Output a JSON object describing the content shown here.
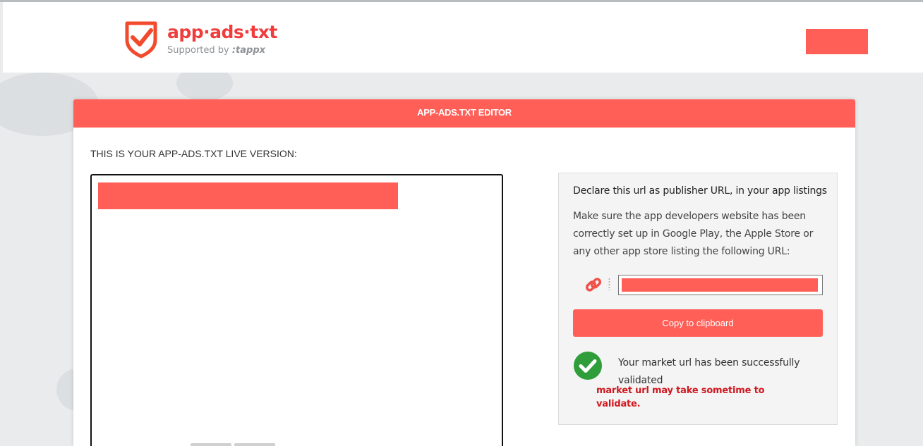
{
  "header": {
    "logo_name": "app·ads·txt",
    "logo_supported": "Supported by",
    "logo_brand": ":tappx",
    "brand_color": "#ff5f57"
  },
  "card": {
    "title": "APP-ADS.TXT EDITOR",
    "live_label": "THIS IS YOUR APP-ADS.TXT LIVE VERSION:"
  },
  "side": {
    "title": "Declare this url as publisher URL, in your app listings",
    "description": "Make sure the app developers website has been correctly set up in Google Play, the Apple Store or any other app store listing the following URL:",
    "copy_label": "Copy to clipboard",
    "validated_text": "Your market url has been successfully validated",
    "link_icon": "link-icon",
    "check_icon": "check-circle-icon",
    "success_color": "#2e9d3a"
  },
  "note": "market url may take sometime to validate."
}
